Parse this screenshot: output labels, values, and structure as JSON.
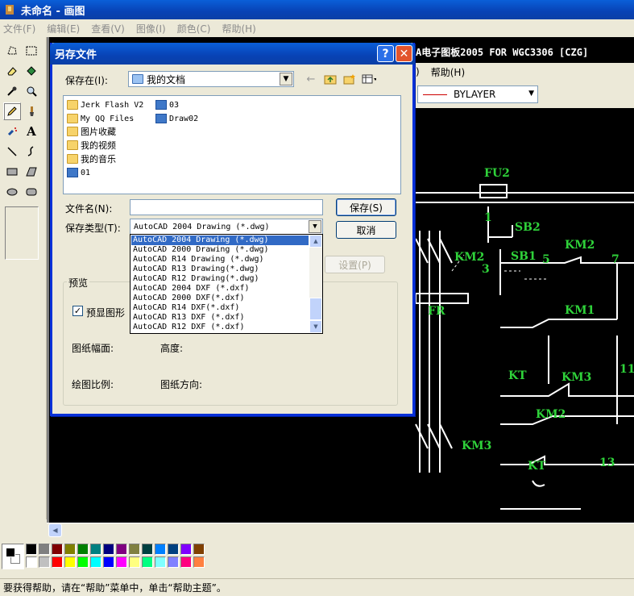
{
  "window": {
    "title": "未命名 - 画图"
  },
  "menu": [
    "文件(F)",
    "编辑(E)",
    "查看(V)",
    "图像(I)",
    "颜色(C)",
    "帮助(H)"
  ],
  "tools": [
    "free-select",
    "rect-select",
    "eraser",
    "fill",
    "color-picker",
    "magnifier",
    "pencil",
    "brush",
    "airbrush",
    "text",
    "line",
    "curve",
    "rectangle",
    "polygon",
    "ellipse",
    "rounded-rect"
  ],
  "autocad": {
    "title": "A电子图板2005 FOR WGC3306 [CZG]",
    "menu": [
      "|)",
      "帮助(H)"
    ],
    "linetype": "BYLAYER"
  },
  "diagram_labels": [
    "FU2",
    "1",
    "SB2",
    "KM2",
    "3",
    "SB1",
    "5",
    "KM2",
    "7",
    "FR",
    "KM1",
    "KT",
    "KM3",
    "11",
    "KM2",
    "KM3",
    "KT",
    "13"
  ],
  "dialog": {
    "title": "另存文件",
    "save_in_label": "保存在(I):",
    "save_in_value": "我的文档",
    "files_left": [
      "Jerk Flash V2",
      "My QQ Files",
      "图片收藏",
      "我的视频",
      "我的音乐",
      "01"
    ],
    "files_right": [
      "03",
      "Draw02"
    ],
    "filename_label": "文件名(N):",
    "filename_value": "",
    "filetype_label": "保存类型(T):",
    "filetype_value": "AutoCAD 2004 Drawing (*.dwg)",
    "filetype_options": [
      "AutoCAD 2004 Drawing (*.dwg)",
      "AutoCAD 2000 Drawing (*.dwg)",
      "AutoCAD R14 Drawing (*.dwg)",
      "AutoCAD R13 Drawing(*.dwg)",
      "AutoCAD R12 Drawing(*.dwg)",
      "AutoCAD 2004 DXF (*.dxf)",
      "AutoCAD 2000 DXF(*.dxf)",
      "AutoCAD R14 DXF(*.dxf)",
      "AutoCAD R13 DXF (*.dxf)",
      "AutoCAD R12 DXF (*.dxf)"
    ],
    "save_button": "保存(S)",
    "cancel_button": "取消",
    "settings_button": "设置(P)",
    "preview_group": "预览",
    "preview_checkbox": "预显图形",
    "paper_size_label": "图纸幅面:",
    "height_label": "高度:",
    "scale_label": "绘图比例:",
    "orientation_label": "图纸方向:"
  },
  "palette_colors": [
    "#000000",
    "#808080",
    "#800000",
    "#808000",
    "#008000",
    "#008080",
    "#000080",
    "#800080",
    "#808040",
    "#004040",
    "#0080ff",
    "#004080",
    "#8000ff",
    "#804000",
    "#ffffff",
    "#c0c0c0",
    "#ff0000",
    "#ffff00",
    "#00ff00",
    "#00ffff",
    "#0000ff",
    "#ff00ff",
    "#ffff80",
    "#00ff80",
    "#80ffff",
    "#8080ff",
    "#ff0080",
    "#ff8040"
  ],
  "status": "要获得帮助，请在“帮助”菜单中，单击“帮助主题”。"
}
